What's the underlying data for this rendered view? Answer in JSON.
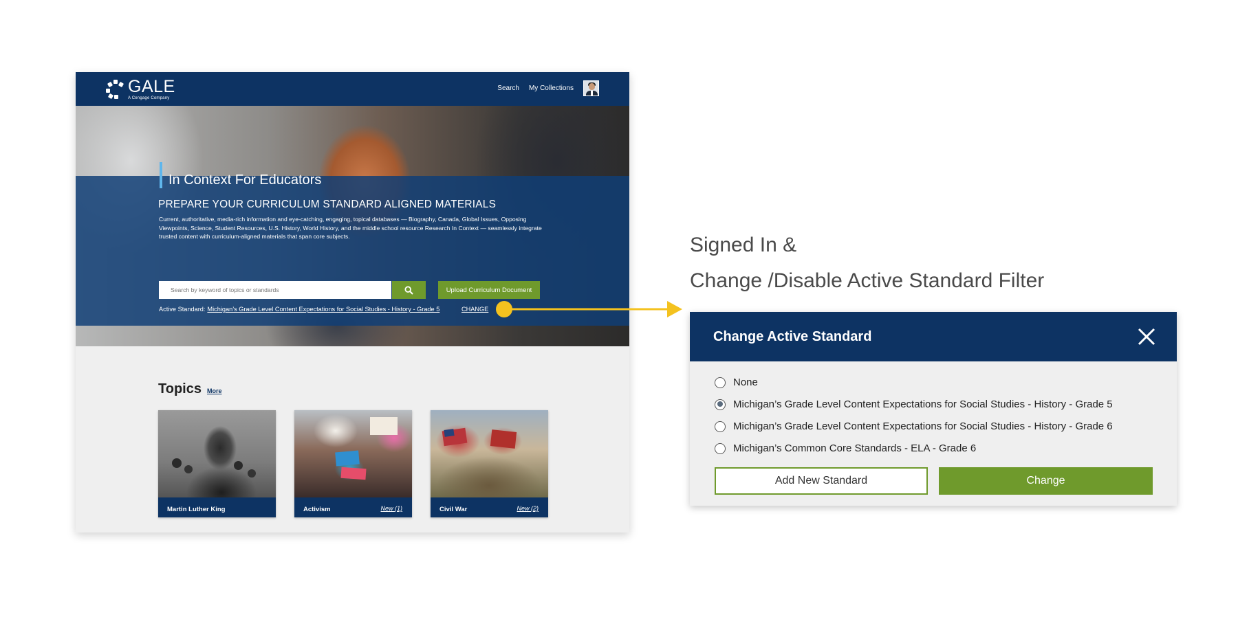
{
  "app": {
    "logo_text": "GALE",
    "logo_subtitle": "A Cengage Company",
    "nav": {
      "search": "Search",
      "collections": "My Collections"
    }
  },
  "hero": {
    "title": "In Context For Educators",
    "subtitle": "PREPARE YOUR CURRICULUM STANDARD ALIGNED MATERIALS",
    "description": "Current, authoritative, media-rich information and eye-catching, engaging, topical databases — Biography, Canada, Global Issues, Opposing Viewpoints, Science, Student Resources, U.S. History, World History, and the middle school resource Research In Context — seamlessly integrate trusted content with curriculum-aligned materials that span core subjects.",
    "search_placeholder": "Search by keyword of topics or standards",
    "upload_label": "Upload Curriculum Document",
    "active_standard_label": "Active Standard:",
    "active_standard_value": "Michigan’s Grade Level Content Expectations for Social Studies - History - Grade 5",
    "change_label": "CHANGE"
  },
  "topics": {
    "title": "Topics",
    "more_label": "More",
    "cards": [
      {
        "label": "Martin Luther King",
        "new": ""
      },
      {
        "label": "Activism",
        "new": "New (1)"
      },
      {
        "label": "Civil War",
        "new": "New (2)"
      }
    ]
  },
  "annotation": {
    "line1": "Signed In &",
    "line2": "Change /Disable Active Standard Filter"
  },
  "modal": {
    "title": "Change Active Standard",
    "options": [
      {
        "label": "None",
        "selected": false
      },
      {
        "label": "Michigan’s Grade Level Content Expectations for Social Studies - History - Grade 5",
        "selected": true
      },
      {
        "label": "Michigan’s Grade Level Content Expectations for Social Studies - History - Grade 6",
        "selected": false
      },
      {
        "label": "Michigan’s Common Core Standards - ELA - Grade 6",
        "selected": false
      }
    ],
    "add_label": "Add New Standard",
    "change_label": "Change"
  },
  "colors": {
    "navy": "#0d3363",
    "green": "#6f9a2c",
    "accent_blue": "#5fb6ec",
    "arrow_yellow": "#f4c21f"
  }
}
